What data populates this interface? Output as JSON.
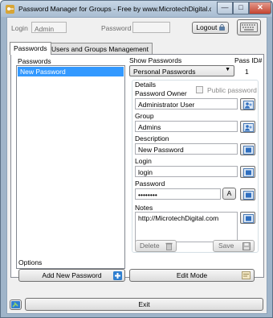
{
  "window": {
    "title": "Password Manager for Groups - Free by www.MicrotechDigital.com",
    "minimize_glyph": "—",
    "maximize_glyph": "□",
    "close_glyph": "✕"
  },
  "topbar": {
    "login_label": "Login",
    "login_value": "Admin",
    "password_label": "Password",
    "password_value": "",
    "logout_label": "Logout"
  },
  "tabs": [
    {
      "label": "Passwords",
      "active": true
    },
    {
      "label": "Users and Groups Management",
      "active": false
    }
  ],
  "passwords_list": {
    "label": "Passwords",
    "items": [
      "New Password"
    ]
  },
  "show_passwords": {
    "label": "Show Passwords",
    "selected": "Personal Passwords"
  },
  "pass_id": {
    "label": "Pass ID#",
    "value": "1"
  },
  "details": {
    "label": "Details",
    "public_label": "Public password",
    "owner_label": "Password Owner",
    "owner_value": "Administrator User",
    "group_label": "Group",
    "group_value": "Admins",
    "description_label": "Description",
    "description_value": "New Password",
    "login_label": "Login",
    "login_value": "login",
    "password_label": "Password",
    "password_value": "••••••••",
    "reveal_label": "A",
    "notes_label": "Notes",
    "notes_value": "http://MicrotechDigital.com",
    "delete_label": "Delete",
    "save_label": "Save"
  },
  "options": {
    "label": "Options",
    "add_label": "Add New Password",
    "edit_label": "Edit Mode"
  },
  "footer": {
    "exit_label": "Exit"
  },
  "colors": {
    "selection": "#3399ff",
    "frame": "#9fb4c9",
    "accent_blue": "#2f7fd0"
  }
}
